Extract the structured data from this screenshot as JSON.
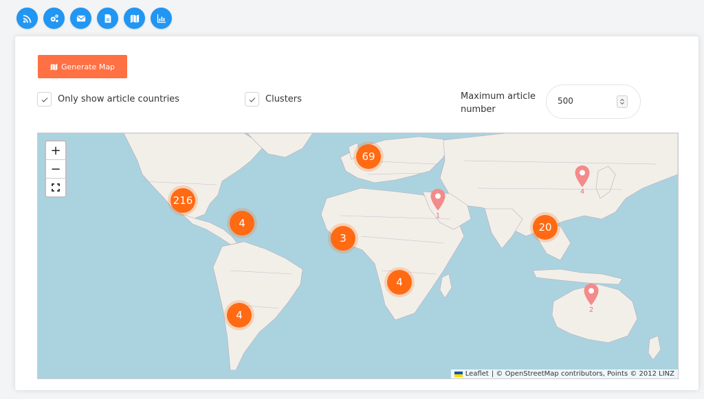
{
  "toolbar": {
    "buttons": [
      {
        "icon": "rss-icon"
      },
      {
        "icon": "gears-icon"
      },
      {
        "icon": "envelope-icon"
      },
      {
        "icon": "file-icon"
      },
      {
        "icon": "map-icon"
      },
      {
        "icon": "chart-icon"
      }
    ],
    "color": "#2196f3"
  },
  "form": {
    "generate_label": "Generate Map",
    "generate_color": "#ff7043",
    "only_article_countries_label": "Only show article countries",
    "only_article_countries_checked": true,
    "clusters_label": "Clusters",
    "clusters_checked": true,
    "max_article_label": "Maximum article number",
    "max_article_value": "500"
  },
  "map": {
    "zoom_in": "+",
    "zoom_out": "−",
    "clusters": [
      {
        "count": "69"
      },
      {
        "count": "216"
      },
      {
        "count": "4"
      },
      {
        "count": "3"
      },
      {
        "count": "20"
      },
      {
        "count": "4"
      },
      {
        "count": "4"
      }
    ],
    "pins": [
      {
        "label": "1"
      },
      {
        "label": "4"
      },
      {
        "label": "2"
      }
    ],
    "attribution": {
      "leaflet": "Leaflet",
      "rest": "| © OpenStreetMap contributors, Points © 2012 LINZ"
    },
    "cluster_color": "#ff6a13",
    "pin_color": "#f48a8a",
    "water_color": "#aad3df",
    "land_color": "#f2efe9"
  }
}
